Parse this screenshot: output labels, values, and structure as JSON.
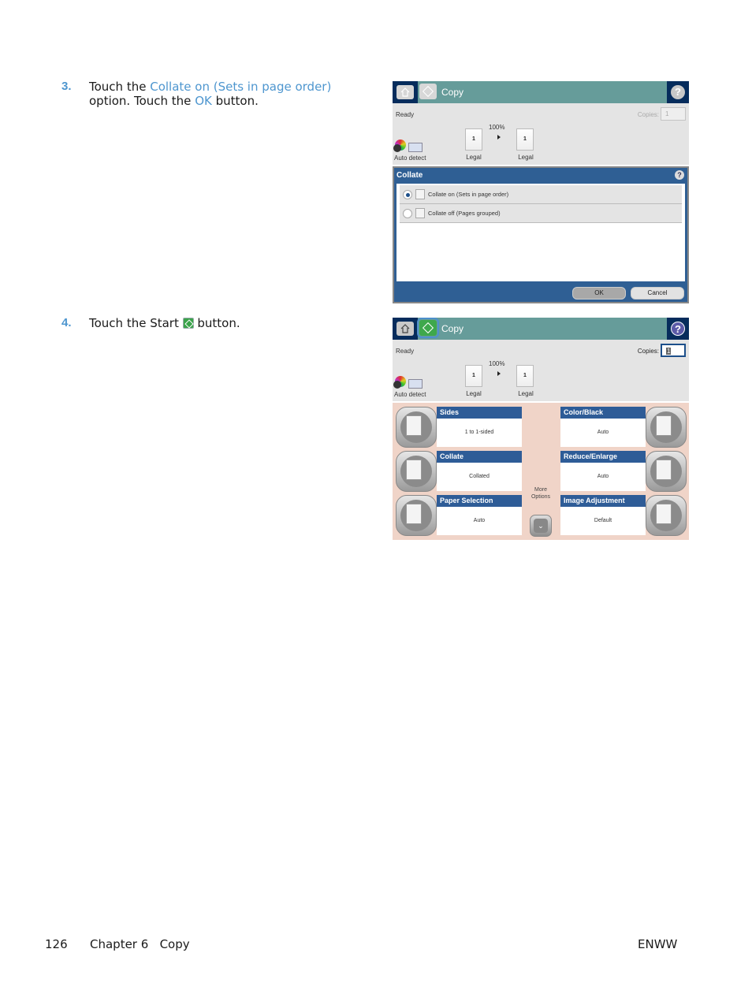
{
  "steps": [
    {
      "number": "3.",
      "text_before": "Touch the ",
      "link1": "Collate on (Sets in page order)",
      "text_mid": " option. Touch the ",
      "link2": "OK",
      "text_after": " button."
    },
    {
      "number": "4.",
      "text_before": "Touch the Start ",
      "icon": "start-icon",
      "text_after": " button."
    }
  ],
  "screen1": {
    "title": "Copy",
    "status": "Ready",
    "copies_label": "Copies:",
    "copies_value": "1",
    "auto_detect": "Auto detect",
    "scale": "100%",
    "original": {
      "count": "1",
      "size": "Legal"
    },
    "output": {
      "count": "1",
      "size": "Legal"
    },
    "dialog": {
      "title": "Collate",
      "options": [
        {
          "label": "Collate on (Sets in page order)",
          "selected": true
        },
        {
          "label": "Collate off (Pages grouped)",
          "selected": false
        }
      ],
      "ok": "OK",
      "cancel": "Cancel"
    }
  },
  "screen2": {
    "title": "Copy",
    "status": "Ready",
    "copies_label": "Copies:",
    "copies_value": "1",
    "auto_detect": "Auto detect",
    "scale": "100%",
    "original": {
      "count": "1",
      "size": "Legal"
    },
    "output": {
      "count": "1",
      "size": "Legal"
    },
    "tiles_left": [
      {
        "title": "Sides",
        "value": "1 to 1-sided"
      },
      {
        "title": "Collate",
        "value": "Collated"
      },
      {
        "title": "Paper Selection",
        "value": "Auto"
      }
    ],
    "tiles_right": [
      {
        "title": "Color/Black",
        "value": "Auto"
      },
      {
        "title": "Reduce/Enlarge",
        "value": "Auto"
      },
      {
        "title": "Image Adjustment",
        "value": "Default"
      }
    ],
    "more_options": "More Options",
    "more_glyph": "⌄"
  },
  "footer": {
    "page_number": "126",
    "chapter": "Chapter 6   Copy",
    "right": "ENWW"
  }
}
